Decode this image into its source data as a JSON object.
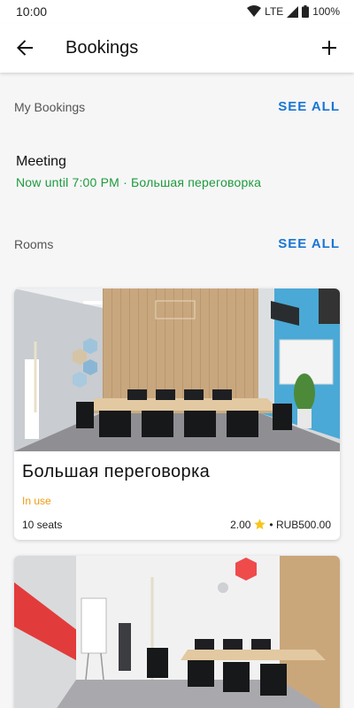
{
  "status_bar": {
    "time": "10:00",
    "network": "LTE",
    "battery": "100%"
  },
  "app_bar": {
    "title": "Bookings"
  },
  "my_bookings": {
    "title": "My Bookings",
    "see_all": "SEE ALL",
    "items": [
      {
        "name": "Meeting",
        "subtitle": "Now until 7:00 PM · Большая  переговорка"
      }
    ]
  },
  "rooms": {
    "title": "Rooms",
    "see_all": "SEE ALL",
    "items": [
      {
        "name": "Большая  переговорка",
        "status": "In use",
        "seats": "10 seats",
        "rating": "2.00",
        "price": "• RUB500.00"
      }
    ]
  },
  "colors": {
    "accent": "#1976d2",
    "active_green": "#1e9a3c",
    "in_use_orange": "#f09a10",
    "star": "#f5c518"
  },
  "icons": {
    "back": "arrow-left-icon",
    "add": "plus-icon",
    "star": "star-icon",
    "wifi": "wifi-icon",
    "signal": "signal-icon",
    "battery": "battery-icon"
  }
}
